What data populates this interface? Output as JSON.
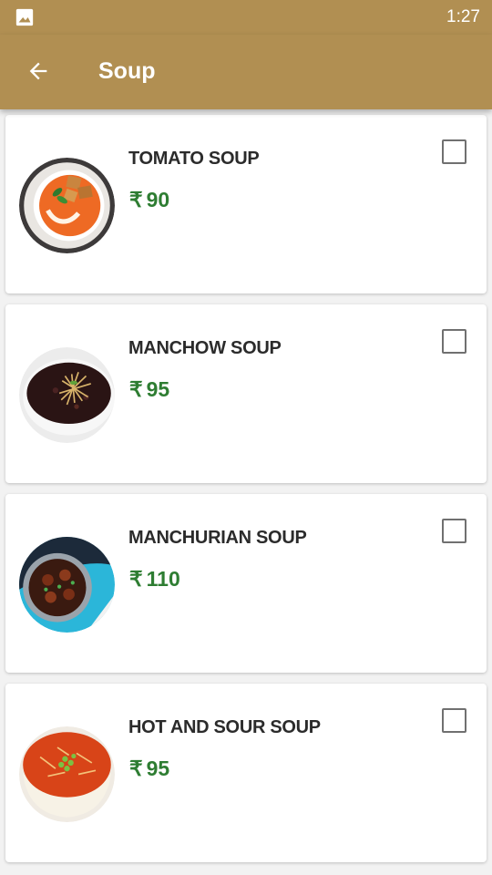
{
  "status_bar": {
    "time": "1:27",
    "left_icon": "image-icon"
  },
  "app_bar": {
    "title": "Soup",
    "back_icon": "arrow-left-icon"
  },
  "currency_symbol": "₹",
  "items": [
    {
      "name": "TOMATO SOUP",
      "price": "90",
      "checked": false
    },
    {
      "name": "MANCHOW SOUP",
      "price": "95",
      "checked": false
    },
    {
      "name": "MANCHURIAN SOUP",
      "price": "110",
      "checked": false
    },
    {
      "name": "HOT AND SOUR SOUP",
      "price": "95",
      "checked": false
    }
  ],
  "colors": {
    "app_bar": "#b18f52",
    "price_text": "#2e7d32",
    "item_name_text": "#2b2b2b",
    "background": "#f2f2f2"
  }
}
